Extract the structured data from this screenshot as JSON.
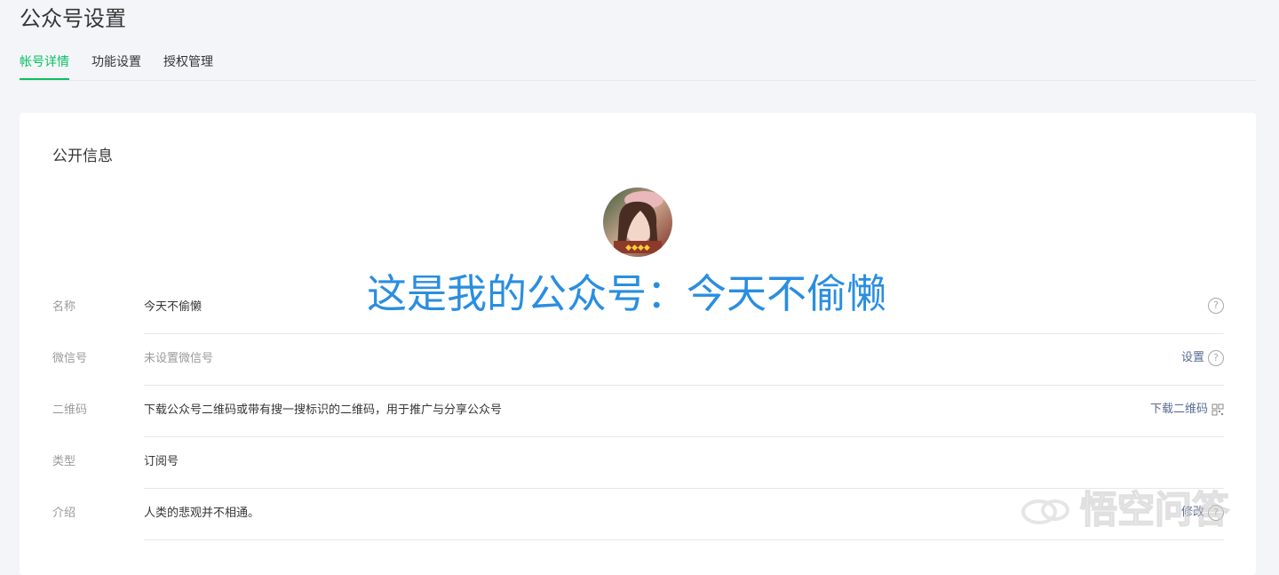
{
  "page": {
    "title": "公众号设置"
  },
  "tabs": [
    {
      "label": "帐号详情",
      "active": true
    },
    {
      "label": "功能设置",
      "active": false
    },
    {
      "label": "授权管理",
      "active": false
    }
  ],
  "card": {
    "section_title": "公开信息",
    "overlay_caption": "这是我的公众号：今天不偷懒",
    "rows": [
      {
        "label": "名称",
        "value": "今天不偷懒",
        "action": ""
      },
      {
        "label": "微信号",
        "value": "未设置微信号",
        "action": "设置"
      },
      {
        "label": "二维码",
        "value": "下载公众号二维码或带有搜一搜标识的二维码，用于推广与分享公众号",
        "action": "下载二维码"
      },
      {
        "label": "类型",
        "value": "订阅号",
        "action": ""
      },
      {
        "label": "介绍",
        "value": "人类的悲观并不相通。",
        "action": "修改"
      }
    ]
  },
  "watermark": {
    "text": "悟空问答"
  },
  "colors": {
    "accent_green": "#07c160",
    "link_blue": "#576b95",
    "overlay_blue": "#2a8ee0"
  },
  "icons": [
    "help-icon",
    "qrcode-icon",
    "avatar-image",
    "wukong-logo-icon"
  ]
}
